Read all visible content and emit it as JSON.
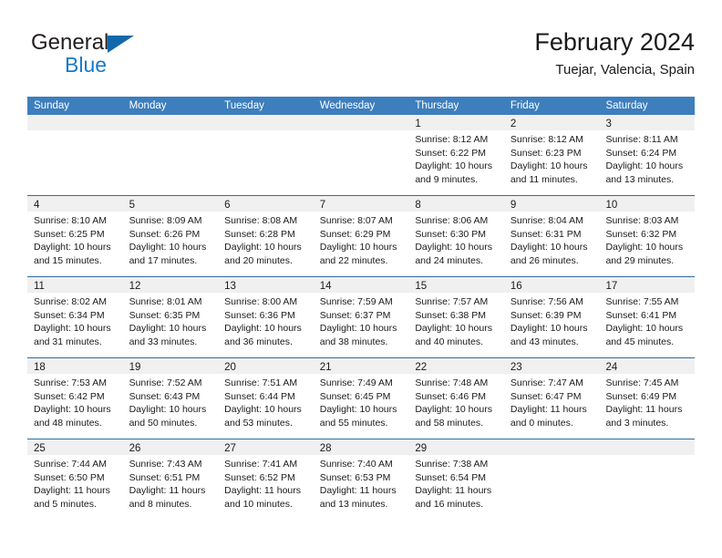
{
  "brand": {
    "name_top": "General",
    "name_bottom": "Blue",
    "triangle_color": "#1368ac",
    "blue_text_color": "#1878c8"
  },
  "header": {
    "title": "February 2024",
    "subtitle": "Tuejar, Valencia, Spain"
  },
  "theme": {
    "header_bg": "#3d7ebd",
    "week_divider": "#2e6da4",
    "daynum_band": "#f0f0f0"
  },
  "weekdays": [
    "Sunday",
    "Monday",
    "Tuesday",
    "Wednesday",
    "Thursday",
    "Friday",
    "Saturday"
  ],
  "weeks": [
    [
      {
        "day": "",
        "lines": []
      },
      {
        "day": "",
        "lines": []
      },
      {
        "day": "",
        "lines": []
      },
      {
        "day": "",
        "lines": []
      },
      {
        "day": "1",
        "lines": [
          "Sunrise: 8:12 AM",
          "Sunset: 6:22 PM",
          "Daylight: 10 hours",
          "and 9 minutes."
        ]
      },
      {
        "day": "2",
        "lines": [
          "Sunrise: 8:12 AM",
          "Sunset: 6:23 PM",
          "Daylight: 10 hours",
          "and 11 minutes."
        ]
      },
      {
        "day": "3",
        "lines": [
          "Sunrise: 8:11 AM",
          "Sunset: 6:24 PM",
          "Daylight: 10 hours",
          "and 13 minutes."
        ]
      }
    ],
    [
      {
        "day": "4",
        "lines": [
          "Sunrise: 8:10 AM",
          "Sunset: 6:25 PM",
          "Daylight: 10 hours",
          "and 15 minutes."
        ]
      },
      {
        "day": "5",
        "lines": [
          "Sunrise: 8:09 AM",
          "Sunset: 6:26 PM",
          "Daylight: 10 hours",
          "and 17 minutes."
        ]
      },
      {
        "day": "6",
        "lines": [
          "Sunrise: 8:08 AM",
          "Sunset: 6:28 PM",
          "Daylight: 10 hours",
          "and 20 minutes."
        ]
      },
      {
        "day": "7",
        "lines": [
          "Sunrise: 8:07 AM",
          "Sunset: 6:29 PM",
          "Daylight: 10 hours",
          "and 22 minutes."
        ]
      },
      {
        "day": "8",
        "lines": [
          "Sunrise: 8:06 AM",
          "Sunset: 6:30 PM",
          "Daylight: 10 hours",
          "and 24 minutes."
        ]
      },
      {
        "day": "9",
        "lines": [
          "Sunrise: 8:04 AM",
          "Sunset: 6:31 PM",
          "Daylight: 10 hours",
          "and 26 minutes."
        ]
      },
      {
        "day": "10",
        "lines": [
          "Sunrise: 8:03 AM",
          "Sunset: 6:32 PM",
          "Daylight: 10 hours",
          "and 29 minutes."
        ]
      }
    ],
    [
      {
        "day": "11",
        "lines": [
          "Sunrise: 8:02 AM",
          "Sunset: 6:34 PM",
          "Daylight: 10 hours",
          "and 31 minutes."
        ]
      },
      {
        "day": "12",
        "lines": [
          "Sunrise: 8:01 AM",
          "Sunset: 6:35 PM",
          "Daylight: 10 hours",
          "and 33 minutes."
        ]
      },
      {
        "day": "13",
        "lines": [
          "Sunrise: 8:00 AM",
          "Sunset: 6:36 PM",
          "Daylight: 10 hours",
          "and 36 minutes."
        ]
      },
      {
        "day": "14",
        "lines": [
          "Sunrise: 7:59 AM",
          "Sunset: 6:37 PM",
          "Daylight: 10 hours",
          "and 38 minutes."
        ]
      },
      {
        "day": "15",
        "lines": [
          "Sunrise: 7:57 AM",
          "Sunset: 6:38 PM",
          "Daylight: 10 hours",
          "and 40 minutes."
        ]
      },
      {
        "day": "16",
        "lines": [
          "Sunrise: 7:56 AM",
          "Sunset: 6:39 PM",
          "Daylight: 10 hours",
          "and 43 minutes."
        ]
      },
      {
        "day": "17",
        "lines": [
          "Sunrise: 7:55 AM",
          "Sunset: 6:41 PM",
          "Daylight: 10 hours",
          "and 45 minutes."
        ]
      }
    ],
    [
      {
        "day": "18",
        "lines": [
          "Sunrise: 7:53 AM",
          "Sunset: 6:42 PM",
          "Daylight: 10 hours",
          "and 48 minutes."
        ]
      },
      {
        "day": "19",
        "lines": [
          "Sunrise: 7:52 AM",
          "Sunset: 6:43 PM",
          "Daylight: 10 hours",
          "and 50 minutes."
        ]
      },
      {
        "day": "20",
        "lines": [
          "Sunrise: 7:51 AM",
          "Sunset: 6:44 PM",
          "Daylight: 10 hours",
          "and 53 minutes."
        ]
      },
      {
        "day": "21",
        "lines": [
          "Sunrise: 7:49 AM",
          "Sunset: 6:45 PM",
          "Daylight: 10 hours",
          "and 55 minutes."
        ]
      },
      {
        "day": "22",
        "lines": [
          "Sunrise: 7:48 AM",
          "Sunset: 6:46 PM",
          "Daylight: 10 hours",
          "and 58 minutes."
        ]
      },
      {
        "day": "23",
        "lines": [
          "Sunrise: 7:47 AM",
          "Sunset: 6:47 PM",
          "Daylight: 11 hours",
          "and 0 minutes."
        ]
      },
      {
        "day": "24",
        "lines": [
          "Sunrise: 7:45 AM",
          "Sunset: 6:49 PM",
          "Daylight: 11 hours",
          "and 3 minutes."
        ]
      }
    ],
    [
      {
        "day": "25",
        "lines": [
          "Sunrise: 7:44 AM",
          "Sunset: 6:50 PM",
          "Daylight: 11 hours",
          "and 5 minutes."
        ]
      },
      {
        "day": "26",
        "lines": [
          "Sunrise: 7:43 AM",
          "Sunset: 6:51 PM",
          "Daylight: 11 hours",
          "and 8 minutes."
        ]
      },
      {
        "day": "27",
        "lines": [
          "Sunrise: 7:41 AM",
          "Sunset: 6:52 PM",
          "Daylight: 11 hours",
          "and 10 minutes."
        ]
      },
      {
        "day": "28",
        "lines": [
          "Sunrise: 7:40 AM",
          "Sunset: 6:53 PM",
          "Daylight: 11 hours",
          "and 13 minutes."
        ]
      },
      {
        "day": "29",
        "lines": [
          "Sunrise: 7:38 AM",
          "Sunset: 6:54 PM",
          "Daylight: 11 hours",
          "and 16 minutes."
        ]
      },
      {
        "day": "",
        "lines": []
      },
      {
        "day": "",
        "lines": []
      }
    ]
  ]
}
